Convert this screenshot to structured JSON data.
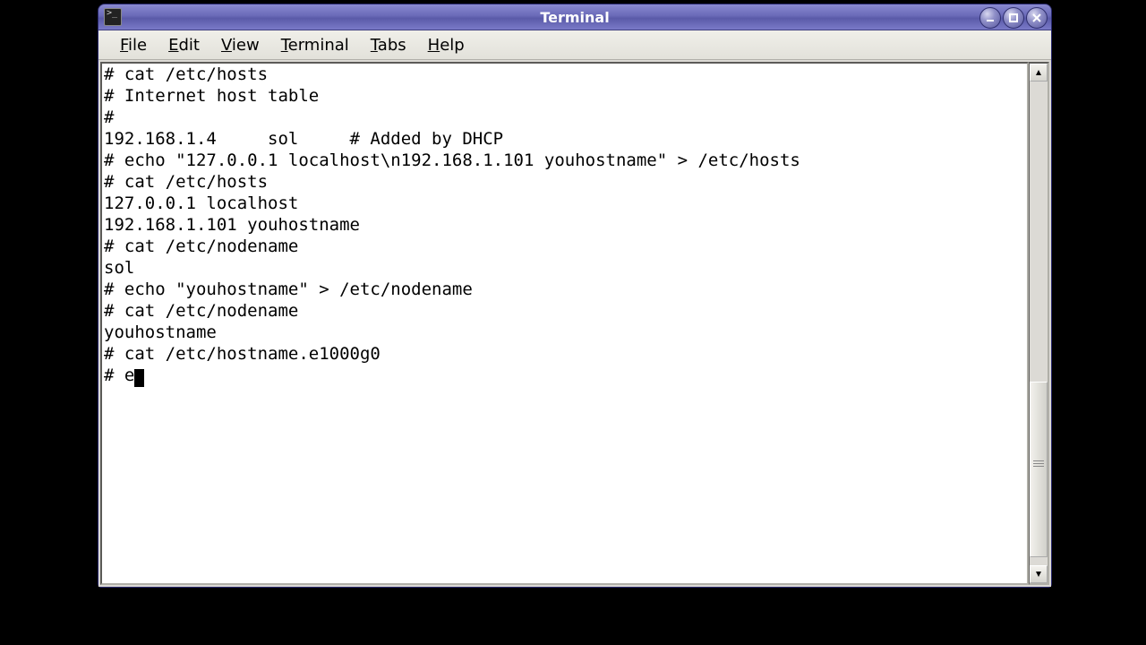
{
  "window": {
    "title": "Terminal"
  },
  "menubar": {
    "items": [
      {
        "accel": "F",
        "rest": "ile"
      },
      {
        "accel": "E",
        "rest": "dit"
      },
      {
        "accel": "V",
        "rest": "iew"
      },
      {
        "accel": "T",
        "rest": "erminal"
      },
      {
        "accel": "T",
        "rest": "abs"
      },
      {
        "accel": "H",
        "rest": "elp"
      }
    ]
  },
  "terminal": {
    "lines": [
      "# cat /etc/hosts",
      "# Internet host table",
      "#",
      "192.168.1.4     sol     # Added by DHCP",
      "# echo \"127.0.0.1 localhost\\n192.168.1.101 youhostname\" > /etc/hosts",
      "# cat /etc/hosts",
      "127.0.0.1 localhost",
      "192.168.1.101 youhostname",
      "# cat /etc/nodename",
      "sol",
      "# echo \"youhostname\" > /etc/nodename",
      "# cat /etc/nodename",
      "youhostname",
      "# cat /etc/hostname.e1000g0"
    ],
    "prompt_prefix": "# ",
    "prompt_input": "e"
  }
}
